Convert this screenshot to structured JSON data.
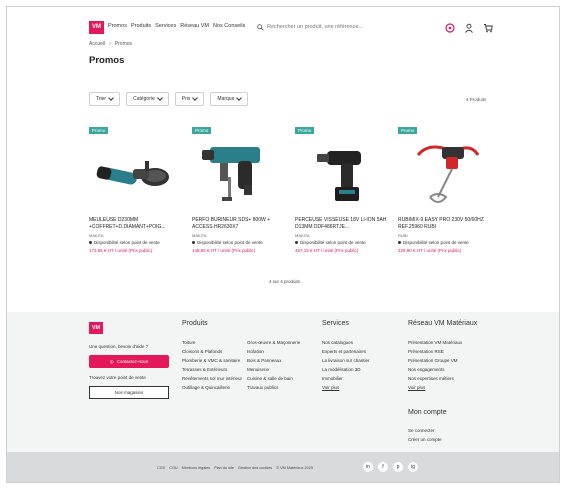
{
  "header": {
    "logo": "VM",
    "nav": [
      "Promos",
      "Produits",
      "Services",
      "Réseau VM",
      "Nos Conseils"
    ],
    "search_placeholder": "Rechercher un produit, une référence..."
  },
  "breadcrumb": [
    "Accueil",
    "Promos"
  ],
  "page_title": "Promos",
  "filters": [
    "Trier",
    "Catégorie",
    "Prix",
    "Marque"
  ],
  "result_count": "4 Produits",
  "products": [
    {
      "badge": "Promo",
      "name": "MEULEUSE D230MM +COFFRET+D.DIAMANT+POIG...",
      "brand": "MAKITA",
      "stock": "Disponibilité selon point de vente",
      "price": "173,55 € HT / unité (Prix public)"
    },
    {
      "badge": "Promo",
      "name": "PERFO BURINEUR SDS+ 800W + ACCESS.HR2630X7",
      "brand": "MAKITA",
      "stock": "Disponibilité selon point de vente",
      "price": "148,95 € HT / unité (Prix public)"
    },
    {
      "badge": "Promo",
      "name": "PERCEUSE VISSEUSE 18V LI-ION 5AH D13MM DDF486RTJE...",
      "brand": "MAKITA",
      "stock": "Disponibilité selon point de vente",
      "price": "457,15 € HT / unité (Prix public)"
    },
    {
      "badge": "Promo",
      "name": "RUBIMIX-9 EASY PRO 230V 50/60HZ REF.25960 RUBI",
      "brand": "RUBI",
      "stock": "Disponibilité selon point de vente",
      "price": "229,90 € HT / unité (Prix public)"
    }
  ],
  "pager": "4 sur 4 produits",
  "footer": {
    "logo": "VM",
    "question": "Une question, besoin d'aide ?",
    "contact_button": "Contactez-nous",
    "stores_text": "Trouvez votre point de vente",
    "stores_button": "Nos magasins",
    "products_title": "Produits",
    "products_col1": [
      "Toiture",
      "Cloisons & Plafonds",
      "Plomberie & VMC & sanitaire",
      "Terrasses & Extérieurs",
      "Revêtements sol mur intérieur",
      "Outillage & Quincaillerie"
    ],
    "products_col2": [
      "Gros-œuvre & Maçonnerie",
      "Isolation",
      "Bois & Panneaux",
      "Menuiserie",
      "Cuisine & salle de bain",
      "Travaux publics"
    ],
    "services_title": "Services",
    "services_links": [
      "Nos catalogues",
      "Experts et partenaires",
      "La livraison sur chantier",
      "La modélisation 3D",
      "Immobilier"
    ],
    "services_more": "Voir plus",
    "reseau_title": "Réseau VM Matériaux",
    "reseau_links": [
      "Présentation VM Matériaux",
      "Présentation RSE",
      "Présentation Groupe VM",
      "Nos engagements",
      "Nos expertises métiers"
    ],
    "reseau_more": "Voir plus",
    "account_title": "Mon compte",
    "account_links": [
      "Se connecter",
      "Créer un compte"
    ]
  },
  "bottom": {
    "legal": [
      "CGV",
      "CGU",
      "Mentions légales",
      "Plan du site",
      "Gestion des cookies",
      "© VM Matériaux 2025"
    ],
    "socials": [
      "in",
      "f",
      "p",
      "ig"
    ]
  }
}
